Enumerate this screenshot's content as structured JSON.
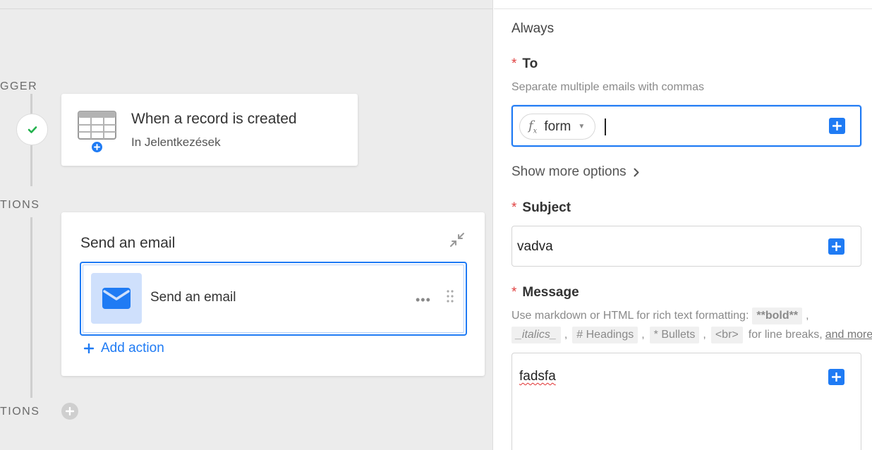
{
  "canvas": {
    "trigger_label": "GGER",
    "actions_label": "TIONS",
    "conditions_label": "TIONS",
    "trigger_card": {
      "title": "When a record is created",
      "subtitle": "In Jelentkezések"
    },
    "action_card": {
      "title": "Send an email",
      "step_label": "Send an email",
      "more_label": "•••",
      "add_action_label": "Add action"
    },
    "colors": {
      "accent": "#1f7bf4",
      "success": "#22b14c",
      "canvas_bg": "#ececec"
    }
  },
  "panel": {
    "condition_text": "Always",
    "to": {
      "label": "To",
      "required": "*",
      "hint": "Separate multiple emails with commas",
      "token_label": "form",
      "token_icon": "function-icon"
    },
    "show_more_label": "Show more options",
    "subject": {
      "label": "Subject",
      "required": "*",
      "value": "vadva"
    },
    "message": {
      "label": "Message",
      "required": "*",
      "hint_prefix": "Use markdown or HTML for rich text formatting:",
      "code_bold": "**bold**",
      "code_italics": "_italics_",
      "code_headings": "# Headings",
      "code_bullets": "* Bullets",
      "code_br": "<br>",
      "hint_suffix": "for line breaks,",
      "link_more": "and more",
      "value": "fadsfa"
    }
  }
}
